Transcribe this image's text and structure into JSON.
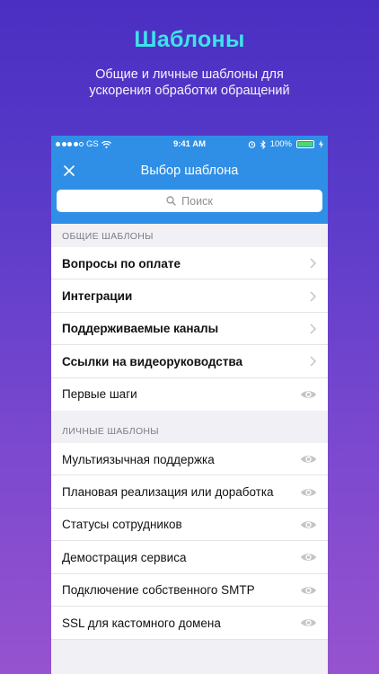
{
  "promo": {
    "title": "Шаблоны",
    "subtitle": "Общие и личные шаблоны для ускорения обработки обращений"
  },
  "status_bar": {
    "carrier": "GS",
    "time": "9:41 AM",
    "battery": "100%"
  },
  "nav": {
    "title": "Выбор шаблона",
    "close_icon": "close-icon"
  },
  "search": {
    "placeholder": "Поиск"
  },
  "sections": [
    {
      "header": "ОБЩИЕ ШАБЛОНЫ",
      "items": [
        {
          "label": "Вопросы по оплате",
          "icon": "chevron-right-icon"
        },
        {
          "label": "Интеграции",
          "icon": "chevron-right-icon"
        },
        {
          "label": "Поддерживаемые каналы",
          "icon": "chevron-right-icon"
        },
        {
          "label": "Ссылки на видеоруководства",
          "icon": "chevron-right-icon"
        },
        {
          "label": "Первые шаги",
          "icon": "eye-icon"
        }
      ]
    },
    {
      "header": "ЛИЧНЫЕ ШАБЛОНЫ",
      "items": [
        {
          "label": "Мультиязычная поддержка",
          "icon": "eye-icon"
        },
        {
          "label": "Плановая реализация или доработка",
          "icon": "eye-icon"
        },
        {
          "label": "Статусы сотрудников",
          "icon": "eye-icon"
        },
        {
          "label": "Демострация сервиса",
          "icon": "eye-icon"
        },
        {
          "label": "Подключение собственного SMTP",
          "icon": "eye-icon"
        },
        {
          "label": "SSL для кастомного домена",
          "icon": "eye-icon"
        }
      ]
    }
  ],
  "colors": {
    "headline": "#3fe3e8",
    "nav_bar": "#2f8fe6",
    "battery": "#4cd964",
    "icon_gray": "#c4c4c9"
  }
}
